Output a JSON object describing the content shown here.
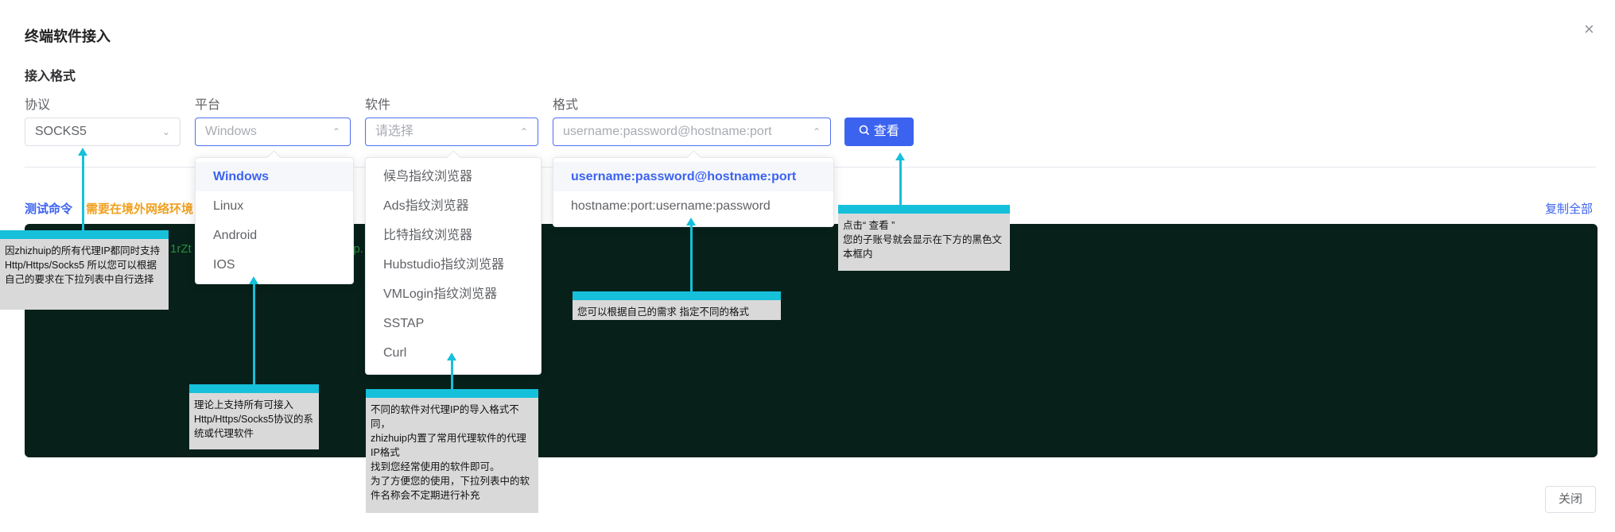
{
  "dialog": {
    "title": "终端软件接入",
    "close_icon": "×",
    "section_title": "接入格式"
  },
  "fields": {
    "protocol": {
      "label": "协议",
      "value": "SOCKS5"
    },
    "platform": {
      "label": "平台",
      "value": "Windows",
      "options": [
        "Windows",
        "Linux",
        "Android",
        "IOS"
      ]
    },
    "software": {
      "label": "软件",
      "placeholder": "请选择",
      "options": [
        "候鸟指纹浏览器",
        "Ads指纹浏览器",
        "比特指纹浏览器",
        "Hubstudio指纹浏览器",
        "VMLogin指纹浏览器",
        "SSTAP",
        "Curl"
      ]
    },
    "format": {
      "label": "格式",
      "value": "username:password@hostname:port",
      "options": [
        "username:password@hostname:port",
        "hostname:port:username:password"
      ]
    }
  },
  "view_button": {
    "icon": "search-icon",
    "label": "查看"
  },
  "command": {
    "label": "测试命令",
    "warning": "需要在境外网络环境",
    "copy_all": "复制全部",
    "fragment_1": "1rZt",
    "fragment_2": "ip."
  },
  "close_button": "关闭",
  "callouts": {
    "protocol": "因zhizhuip的所有代理IP都同时支持Http/Https/Socks5 所以您可以根据自己的要求在下拉列表中自行选择",
    "platform": "理论上支持所有可接入Http/Https/Socks5协议的系统或代理软件",
    "software": "不同的软件对代理IP的导入格式不同，\nzhizhuip内置了常用代理软件的代理IP格式\n找到您经常使用的软件即可。\n为了方便您的使用，下拉列表中的软件名称会不定期进行补充",
    "format": "您可以根据自己的需求 指定不同的格式",
    "view": "点击“ 查看 ”\n您的子账号就会显示在下方的黑色文本框内"
  },
  "colors": {
    "accent": "#3c63f0",
    "callout_bar": "#16c0da",
    "terminal_bg": "#07201a",
    "warning": "#f0a020"
  }
}
